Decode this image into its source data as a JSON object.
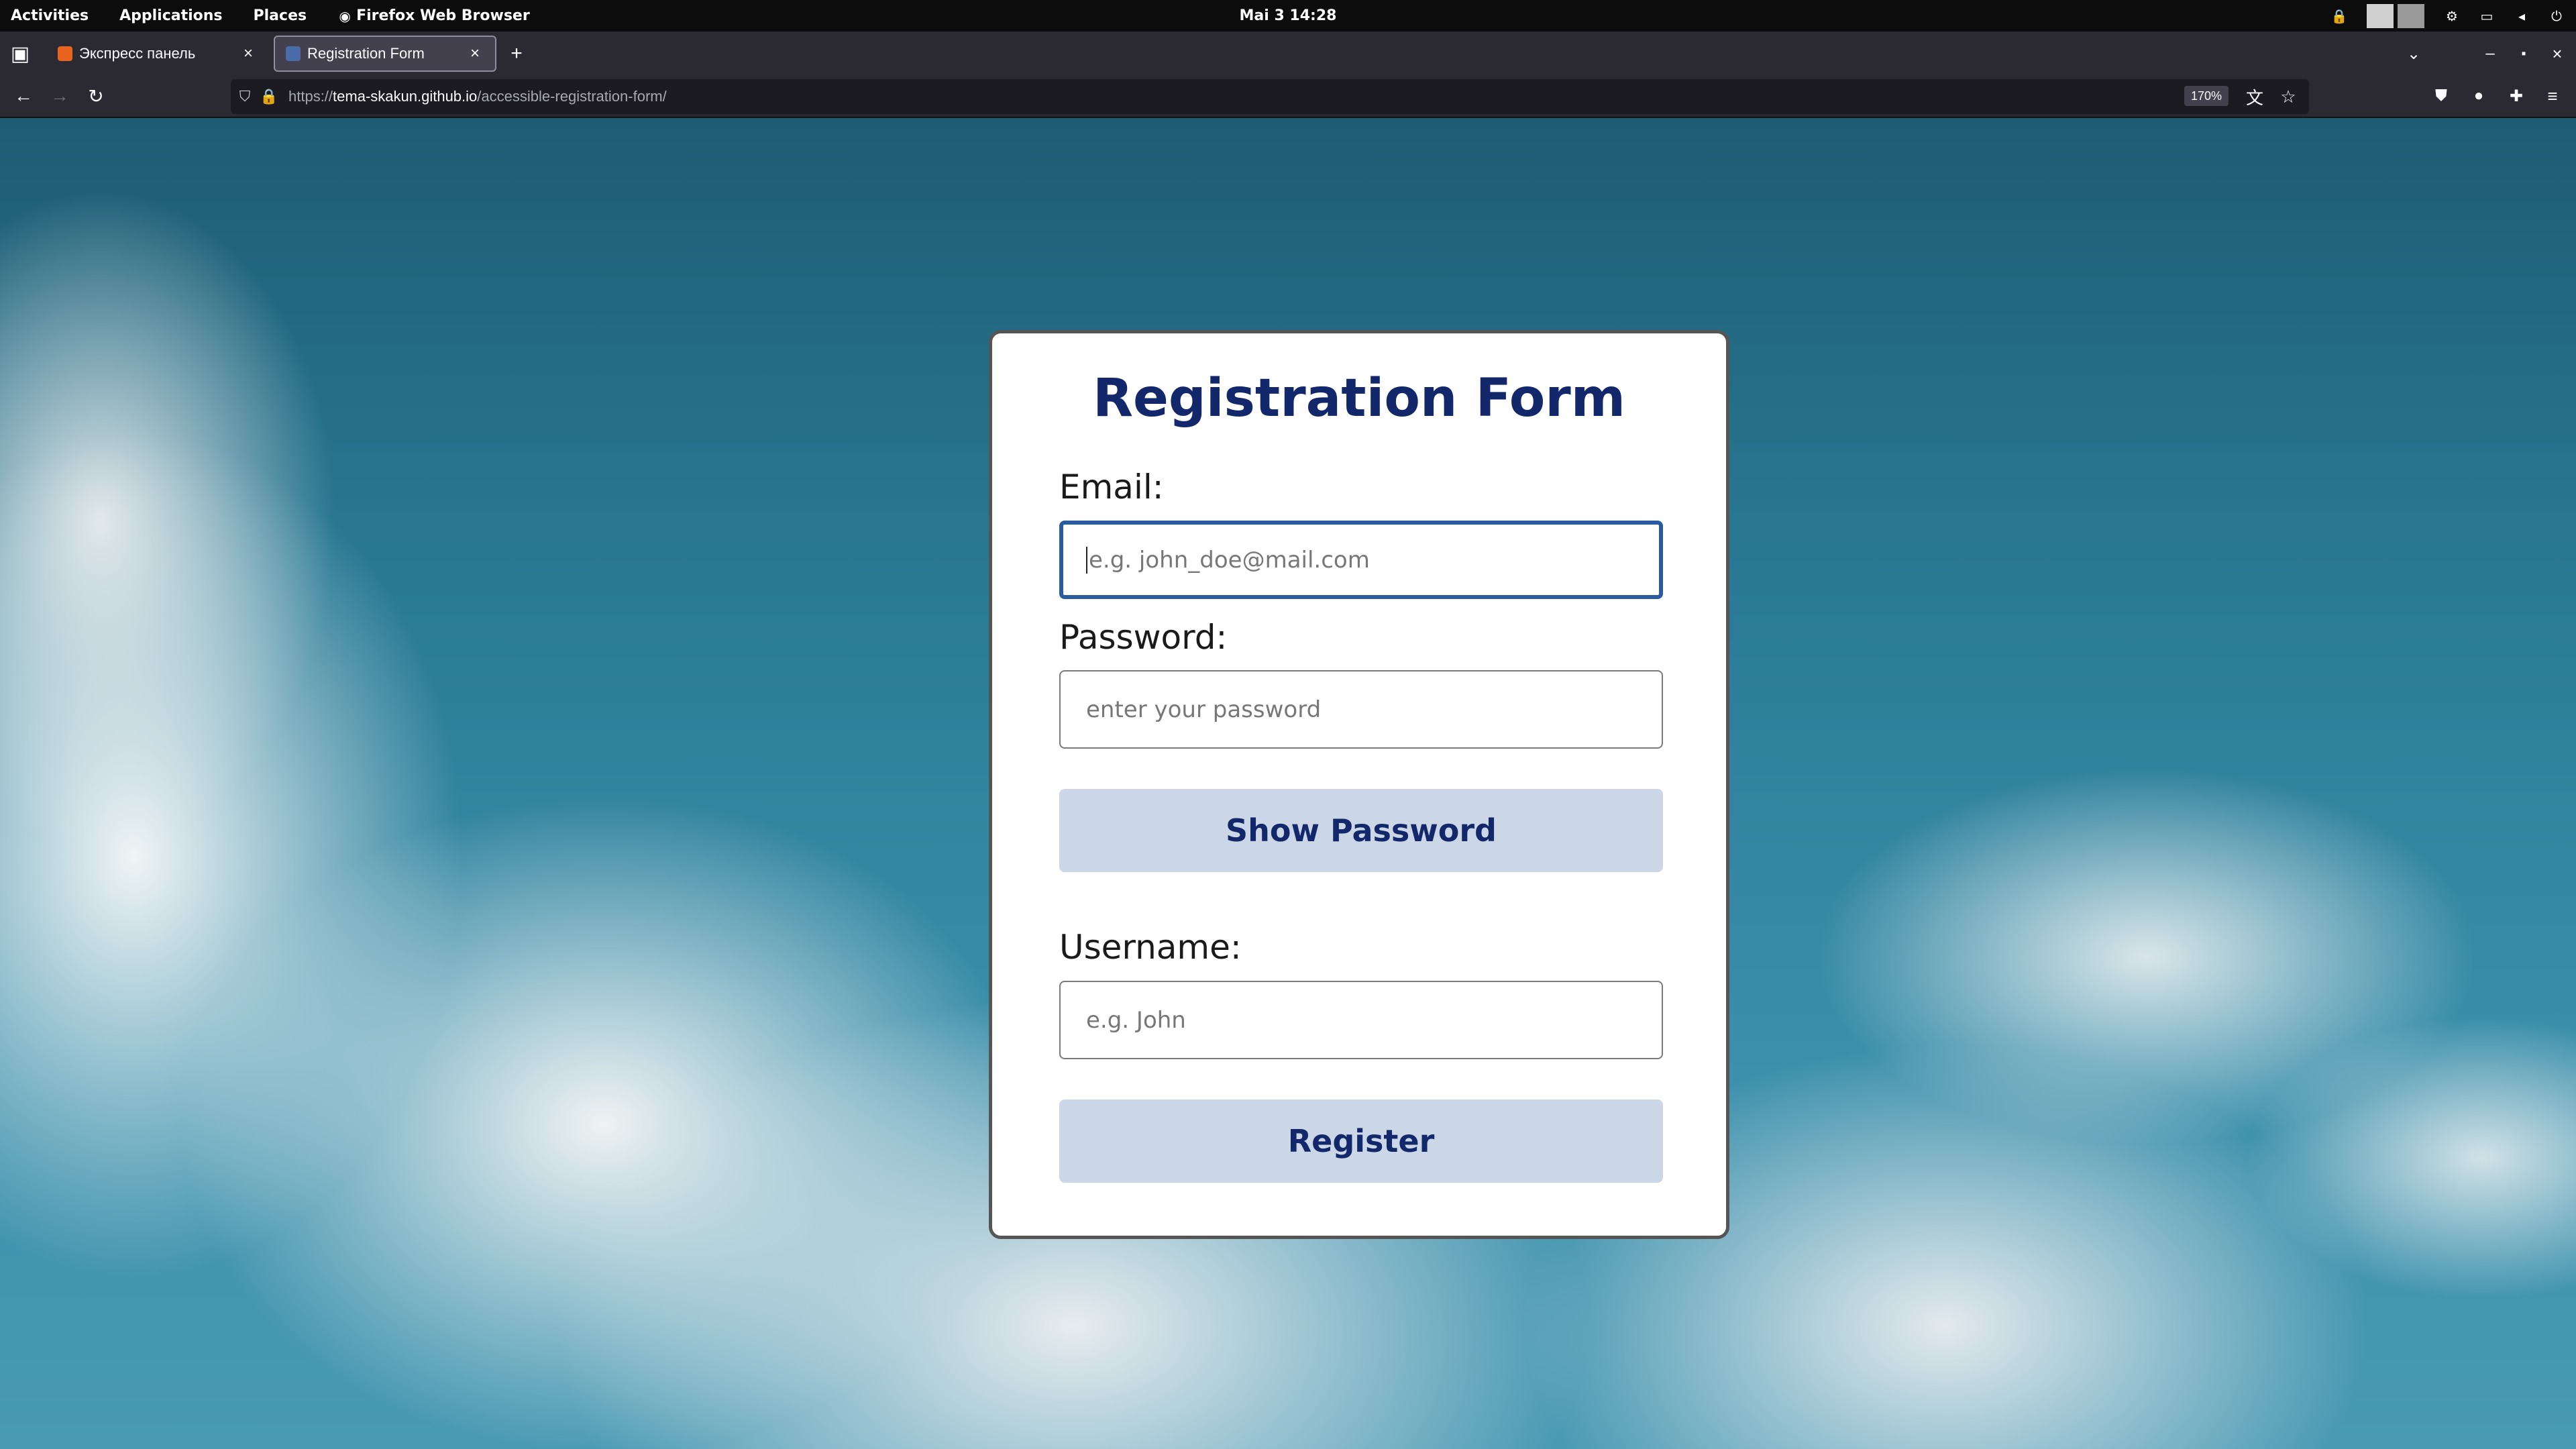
{
  "topbar": {
    "activities": "Activities",
    "applications": "Applications",
    "places": "Places",
    "app_name": "Firefox Web Browser",
    "clock": "Mai 3  14:28"
  },
  "tabs": [
    {
      "label": "Экспресс панель",
      "favicon_color": "#e8641f"
    },
    {
      "label": "Registration Form",
      "favicon_color": "#4a6aa8"
    }
  ],
  "navbar": {
    "url_scheme": "https://",
    "url_host": "tema-skakun.github.io",
    "url_path": "/accessible-registration-form/",
    "zoom": "170%"
  },
  "form": {
    "title": "Registration Form",
    "email_label": "Email:",
    "email_placeholder": "e.g. john_doe@mail.com",
    "password_label": "Password:",
    "password_placeholder": "enter your password",
    "show_password_label": "Show Password",
    "username_label": "Username:",
    "username_placeholder": "e.g. John",
    "register_label": "Register"
  },
  "colors": {
    "title": "#13286b",
    "button_bg": "#cbd7e6",
    "focus_ring": "#2a5aa0"
  }
}
